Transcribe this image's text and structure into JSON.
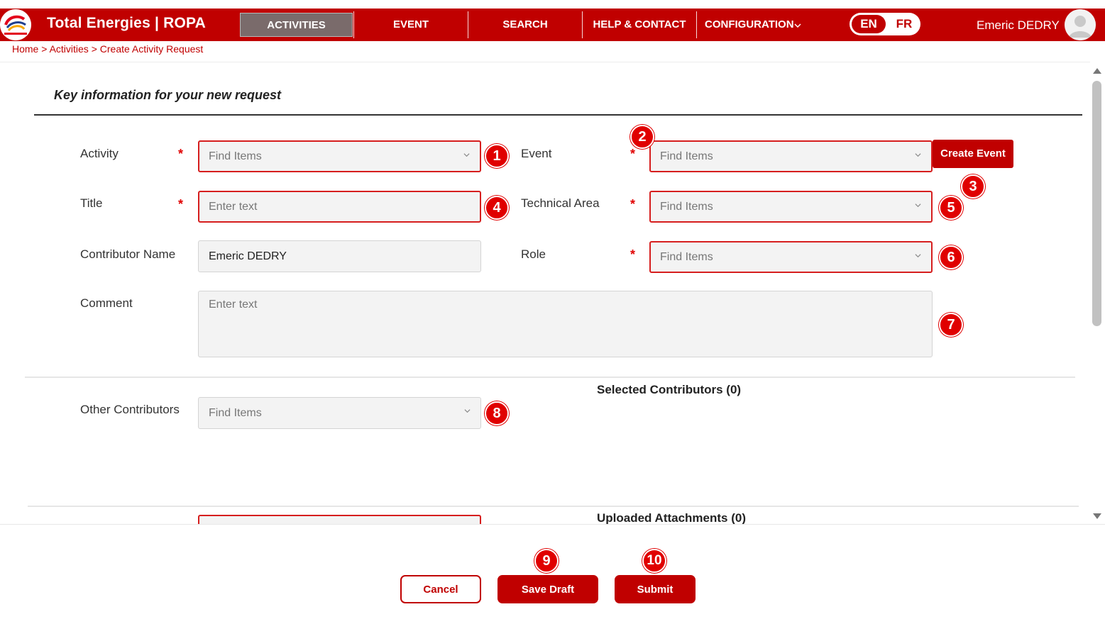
{
  "header": {
    "app_title": "Total Energies | ROPA",
    "nav": [
      "ACTIVITIES",
      "EVENT",
      "SEARCH",
      "HELP & CONTACT",
      "CONFIGURATION"
    ],
    "active_nav": "ACTIVITIES",
    "language": {
      "en": "EN",
      "fr": "FR",
      "selected": "EN"
    },
    "user_name": "Emeric DEDRY",
    "brand_color": "#c00000"
  },
  "breadcrumb": [
    "Home",
    ">",
    "Activities",
    ">",
    "Create Activity Request"
  ],
  "form": {
    "section_title": "Key information for your new request",
    "activity": {
      "label": "Activity",
      "required": "*",
      "placeholder": "Find Items",
      "badge": "1"
    },
    "event": {
      "label": "Event",
      "required": "*",
      "placeholder": "Find Items",
      "badge": "2"
    },
    "create_event": {
      "label": "Create Event",
      "badge": "3"
    },
    "title": {
      "label": "Title",
      "required": "*",
      "placeholder": "Enter text",
      "badge": "4"
    },
    "technical_area": {
      "label": "Technical Area",
      "required": "*",
      "placeholder": "Find Items",
      "badge": "5"
    },
    "contributor_name": {
      "label": "Contributor Name",
      "value": "Emeric DEDRY"
    },
    "role": {
      "label": "Role",
      "required": "*",
      "placeholder": "Find Items",
      "badge": "6"
    },
    "comment": {
      "label": "Comment",
      "placeholder": "Enter text",
      "badge": "7"
    },
    "other_contributors": {
      "label": "Other Contributors",
      "placeholder": "Find Items",
      "badge": "8"
    },
    "selected_contributors": "Selected Contributors (0)",
    "uploaded_attachments": "Uploaded Attachments (0)"
  },
  "footer": {
    "cancel": "Cancel",
    "save_draft": {
      "label": "Save Draft",
      "badge": "9"
    },
    "submit": {
      "label": "Submit",
      "badge": "10"
    }
  }
}
